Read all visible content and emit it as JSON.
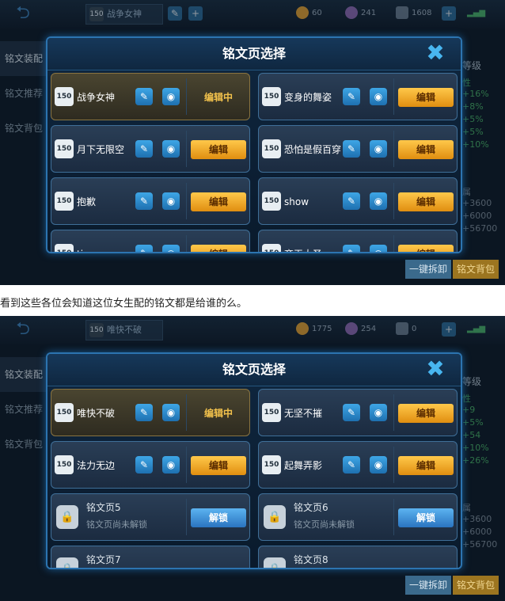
{
  "caption": "看到这些各位会知道这位女生配的铭文都是给谁的么。",
  "shots": [
    {
      "topbar": {
        "page_badge": "150",
        "page_name": "战争女神",
        "gold": "60",
        "gems": "241",
        "coupons": "1608"
      },
      "left_menu": [
        "铭文装配",
        "铭文推荐",
        "铭文背包"
      ],
      "right_header": "等级",
      "right_stats": [
        "性",
        "+16%",
        "+8%",
        "+5%",
        "+5%",
        "+10%"
      ],
      "right_stats2": [
        "属",
        "+3600",
        "+6000",
        "+56700"
      ],
      "bottom_buttons": [
        "一键拆卸",
        "铭文背包"
      ],
      "modal": {
        "title": "铭文页选择",
        "close": "✖"
      },
      "cards": [
        {
          "type": "page",
          "badge": "150",
          "name": "战争女神",
          "action": "编辑中",
          "active": true
        },
        {
          "type": "page",
          "badge": "150",
          "name": "变身的舞姿",
          "action": "编辑",
          "active": false
        },
        {
          "type": "page",
          "badge": "150",
          "name": "月下无限空",
          "action": "编辑",
          "active": false
        },
        {
          "type": "page",
          "badge": "150",
          "name": "恐怕是假百穿",
          "action": "编辑",
          "active": false
        },
        {
          "type": "page",
          "badge": "150",
          "name": "抱歉",
          "action": "编辑",
          "active": false
        },
        {
          "type": "page",
          "badge": "150",
          "name": "show",
          "action": "编辑",
          "active": false
        },
        {
          "type": "page",
          "badge": "150",
          "name": "time",
          "action": "编辑",
          "active": false
        },
        {
          "type": "page",
          "badge": "150",
          "name": "齐天大圣",
          "action": "编辑",
          "active": false
        }
      ]
    },
    {
      "topbar": {
        "page_badge": "150",
        "page_name": "唯快不破",
        "gold": "1775",
        "gems": "254",
        "coupons": "0"
      },
      "left_menu": [
        "铭文装配",
        "铭文推荐",
        "铭文背包"
      ],
      "right_header": "等级",
      "right_stats": [
        "性",
        "+9",
        "+5%",
        "+54",
        "+10%",
        "+26%"
      ],
      "right_stats2": [
        "属",
        "+3600",
        "+6000",
        "+56700"
      ],
      "bottom_buttons": [
        "一键拆卸",
        "铭文背包"
      ],
      "modal": {
        "title": "铭文页选择",
        "close": "✖"
      },
      "cards": [
        {
          "type": "page",
          "badge": "150",
          "name": "唯快不破",
          "action": "编辑中",
          "active": true
        },
        {
          "type": "page",
          "badge": "150",
          "name": "无坚不摧",
          "action": "编辑",
          "active": false
        },
        {
          "type": "page",
          "badge": "150",
          "name": "法力无边",
          "action": "编辑",
          "active": false
        },
        {
          "type": "page",
          "badge": "150",
          "name": "起舞弄影",
          "action": "编辑",
          "active": false
        },
        {
          "type": "locked",
          "title": "铭文页5",
          "sub": "铭文页尚未解锁",
          "action": "解锁"
        },
        {
          "type": "locked",
          "title": "铭文页6",
          "sub": "铭文页尚未解锁",
          "action": "解锁"
        },
        {
          "type": "locked",
          "title": "铭文页7",
          "sub": "",
          "action": ""
        },
        {
          "type": "locked",
          "title": "铭文页8",
          "sub": "",
          "action": ""
        }
      ]
    }
  ]
}
